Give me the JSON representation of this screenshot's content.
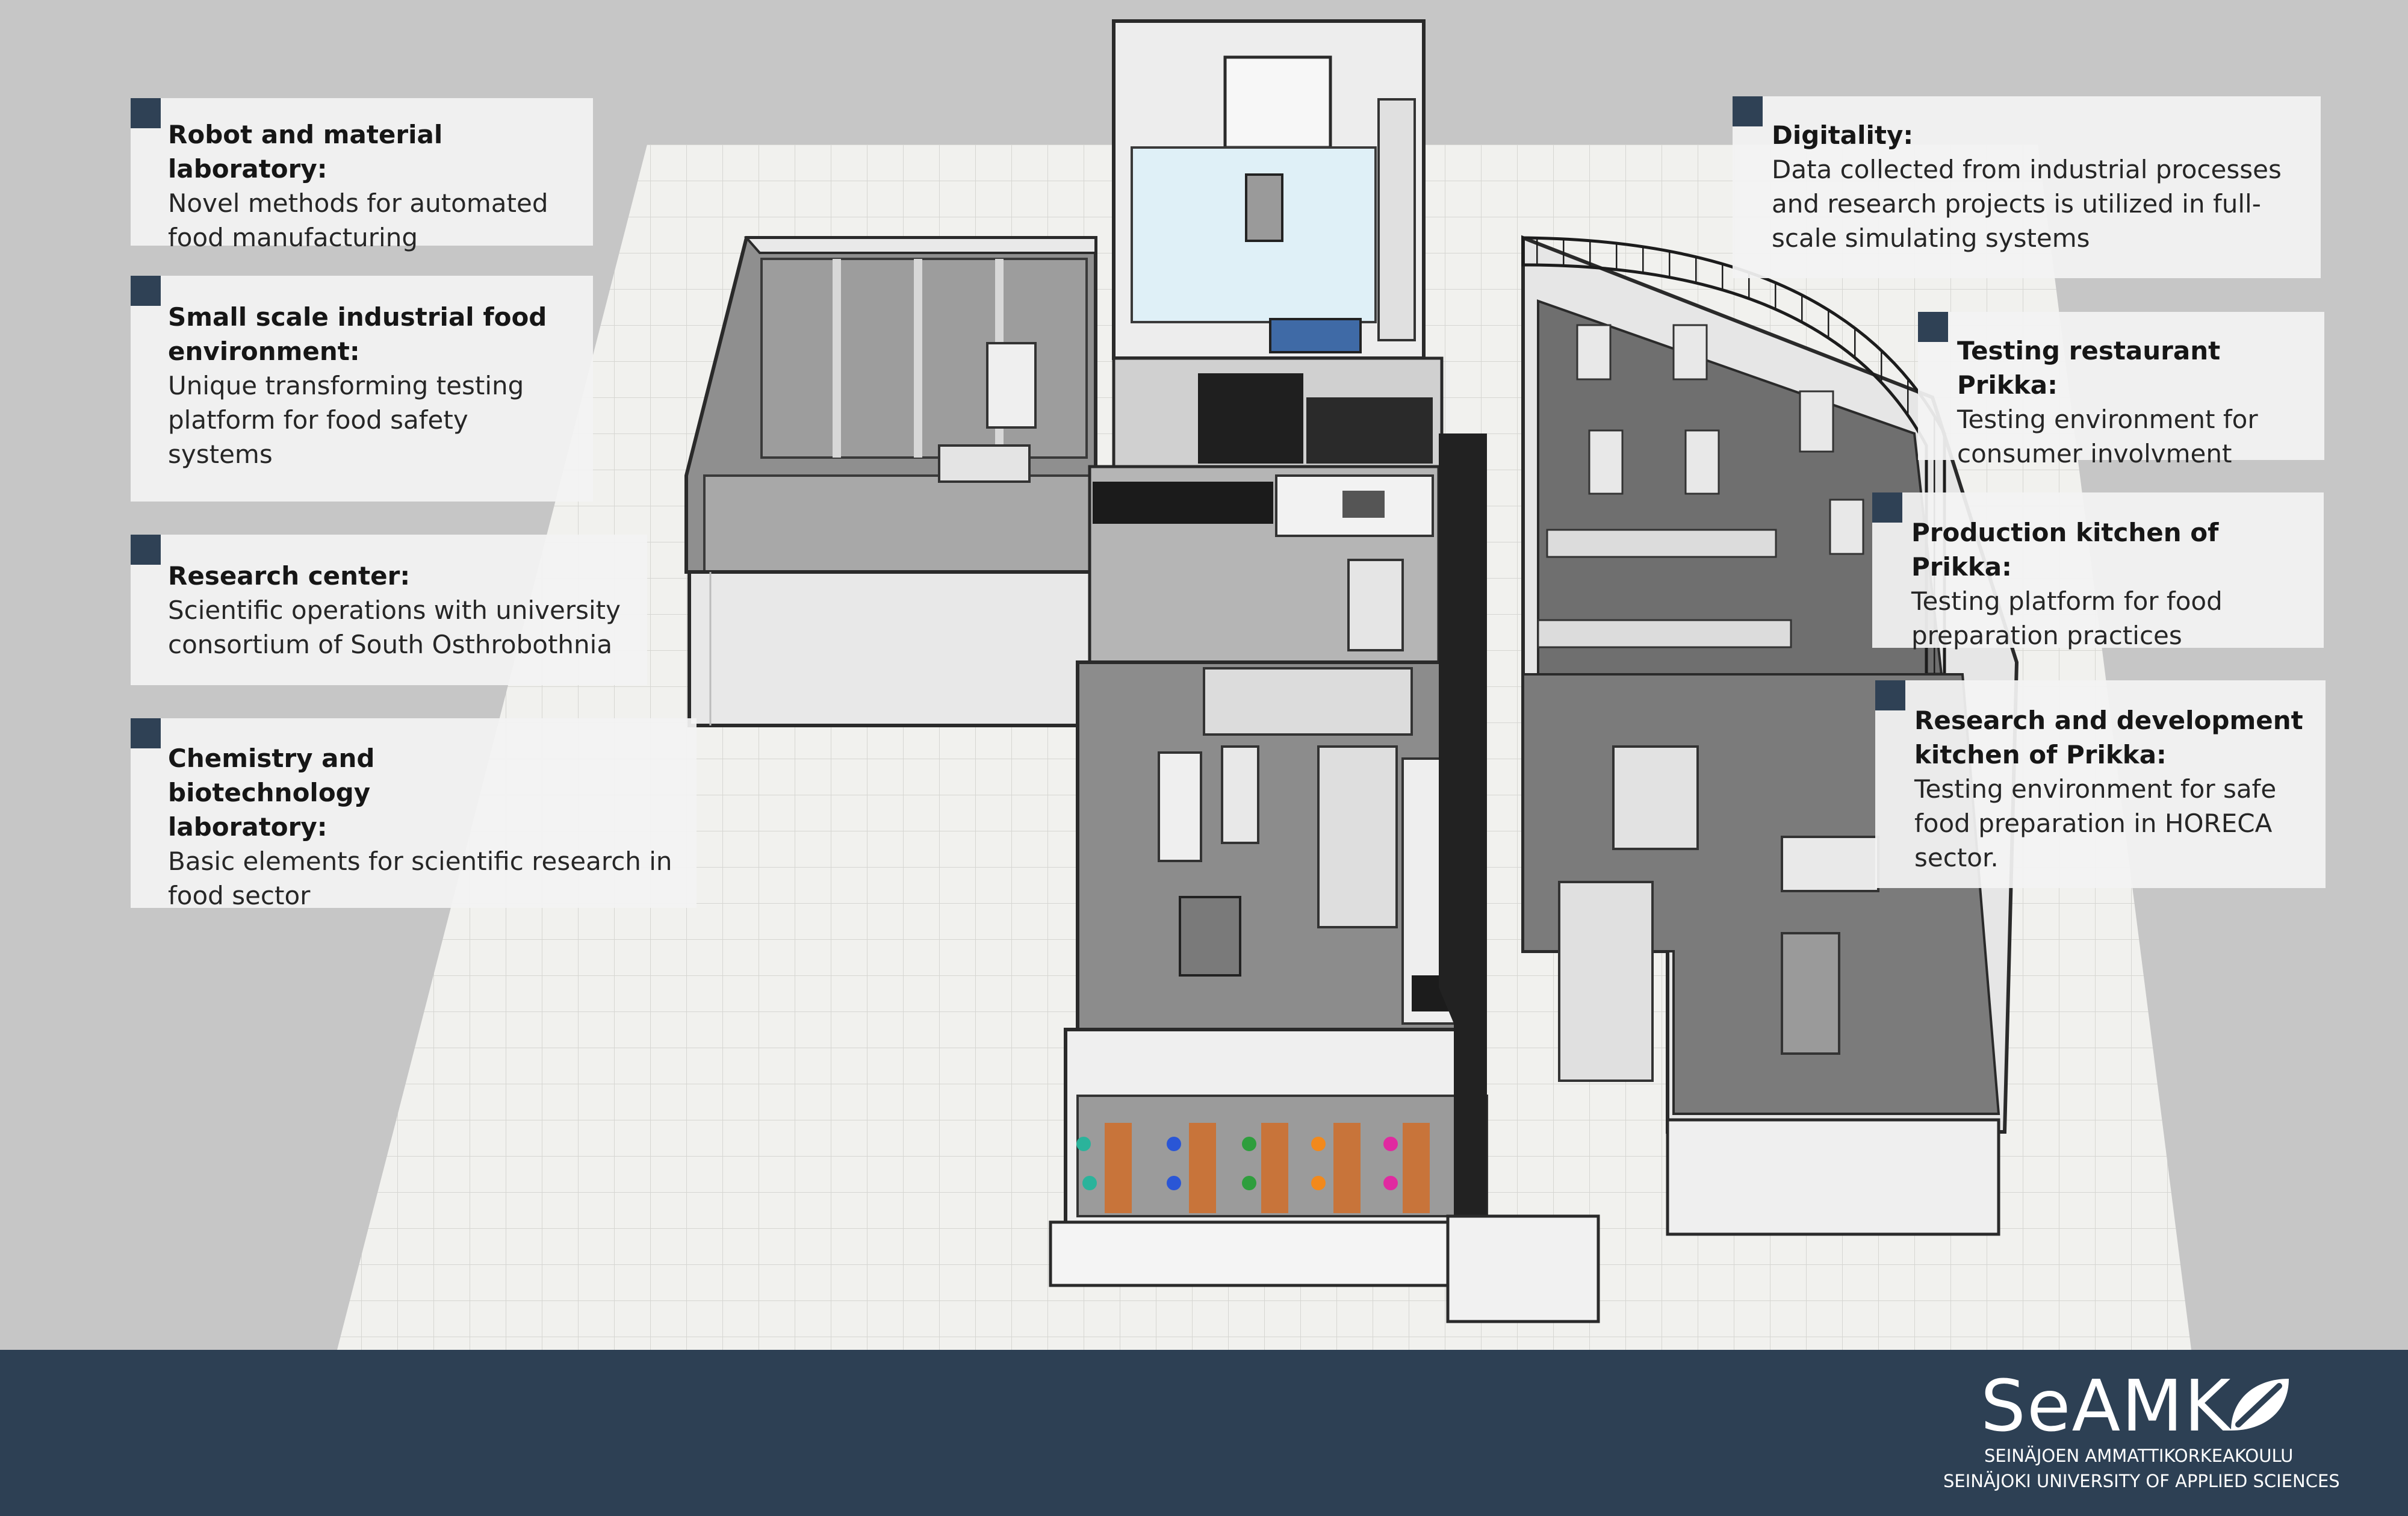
{
  "callouts": {
    "robot": {
      "title": "Robot and material laboratory:",
      "body": "Novel methods for automated food manufacturing"
    },
    "small_scale": {
      "title": "Small scale industrial food environment:",
      "body": "Unique transforming testing platform for food safety systems"
    },
    "research_center": {
      "title": "Research center:",
      "body": "Scientific operations with university consortium of South Osthrobothnia"
    },
    "chemistry": {
      "title": "Chemistry and biotechnology laboratory:",
      "body": "Basic elements for scientific research in food sector"
    },
    "digitality": {
      "title": "Digitality:",
      "body": "Data collected from industrial processes and research projects is utilized in full-scale simulating systems"
    },
    "testing_restaurant": {
      "title": "Testing restaurant Prikka:",
      "body": "Testing environment for consumer involvment"
    },
    "production_kitchen": {
      "title": "Production kitchen of Prikka:",
      "body": "Testing platform for food preparation practices"
    },
    "rd_kitchen": {
      "title": "Research and development kitchen of Prikka:",
      "body": "Testing environment for safe food preparation in HORECA sector."
    }
  },
  "footer": {
    "logo_text": "SeAMK",
    "institution_fi": "SEINÄJOEN AMMATTIKORKEAKOULU",
    "institution_en": "SEINÄJOKI UNIVERSITY OF APPLIED SCIENCES"
  },
  "colors": {
    "background": "#c6c6c6",
    "footer": "#2d4054",
    "marker": "#2f4155",
    "callout_bg": "#f3f3f3"
  }
}
